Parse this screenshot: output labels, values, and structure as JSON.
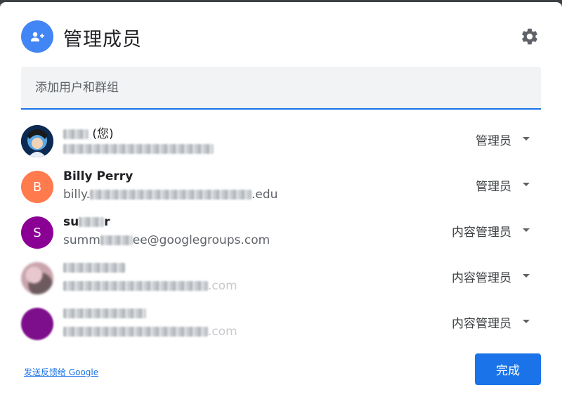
{
  "dialog": {
    "title": "管理成员",
    "add_input_placeholder": "添加用户和群组",
    "feedback_link": "发送反馈给 Google",
    "done_label": "完成"
  },
  "members": [
    {
      "name_suffix": "(您)",
      "role": "管理员",
      "avatar_type": "photo"
    },
    {
      "name": "Billy Perry",
      "email_prefix": "billy.",
      "email_suffix": ".edu",
      "role": "管理员",
      "avatar_letter": "B",
      "avatar_color": "#ff7a4d"
    },
    {
      "name_prefix": "su",
      "name_suffix": "r",
      "email_prefix": "summ",
      "email_suffix": "ee@googlegroups.com",
      "role": "内容管理员",
      "avatar_letter": "S",
      "avatar_color": "#8b0094"
    },
    {
      "email_suffix": ".com",
      "role": "内容管理员",
      "avatar_type": "blurred"
    },
    {
      "email_suffix": ".com",
      "role": "内容管理员",
      "avatar_type": "blurred-purple"
    }
  ],
  "colors": {
    "accent": "#1a73e8",
    "header_avatar": "#4285f4"
  },
  "icons": {
    "header_avatar": "add-person-icon",
    "settings": "gear-icon",
    "role_dropdown": "caret-down-icon"
  }
}
